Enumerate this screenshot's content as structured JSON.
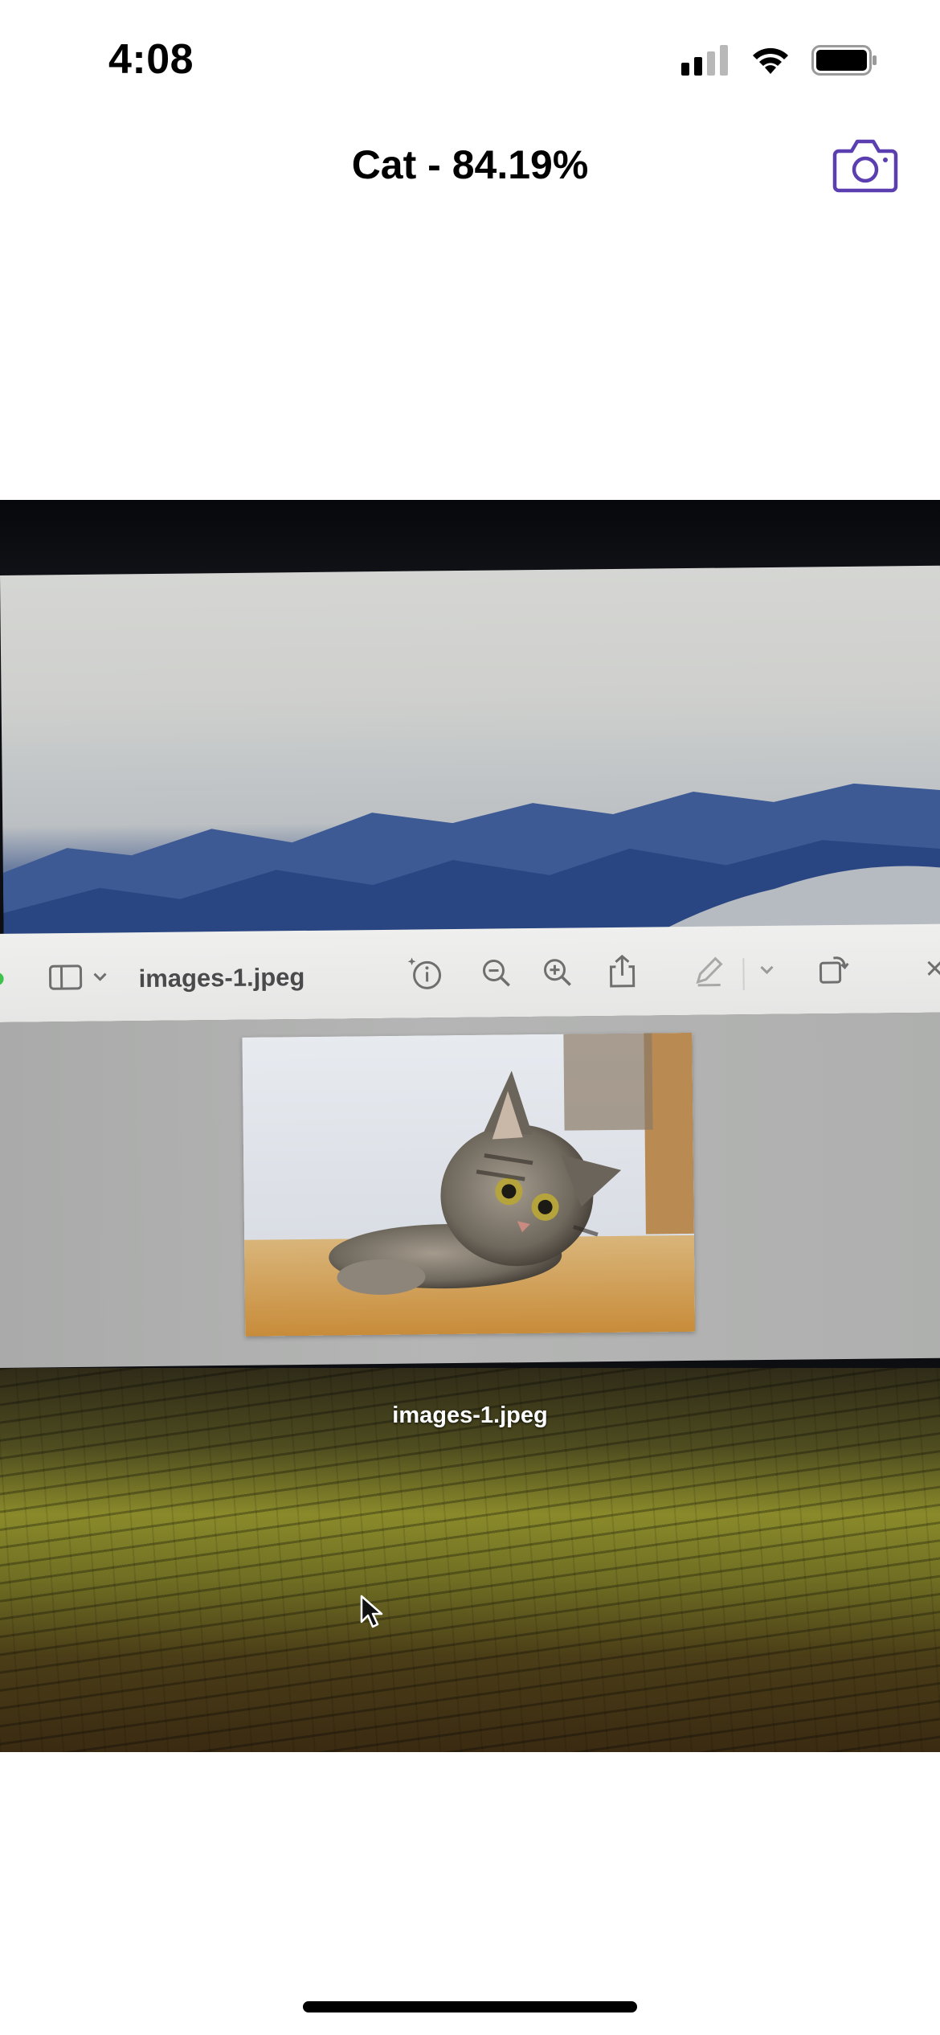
{
  "status_bar": {
    "time": "4:08",
    "icons": [
      "cellular-signal-icon",
      "wifi-icon",
      "battery-icon"
    ]
  },
  "nav": {
    "title": "Cat - 84.19%",
    "camera_icon": "camera-icon",
    "accent_color": "#5b3fb0"
  },
  "photo": {
    "preview_window": {
      "title": "images-1.jpeg",
      "toolbar_icons": [
        "sidebar-icon",
        "chevron-down-icon",
        "info-sparkle-icon",
        "zoom-out-icon",
        "zoom-in-icon",
        "share-icon",
        "markup-pen-icon",
        "chevron-down-icon",
        "rotate-icon",
        "close-icon"
      ],
      "image_subject": "cat-photo"
    },
    "desktop_file_label": "images-1.jpeg"
  }
}
